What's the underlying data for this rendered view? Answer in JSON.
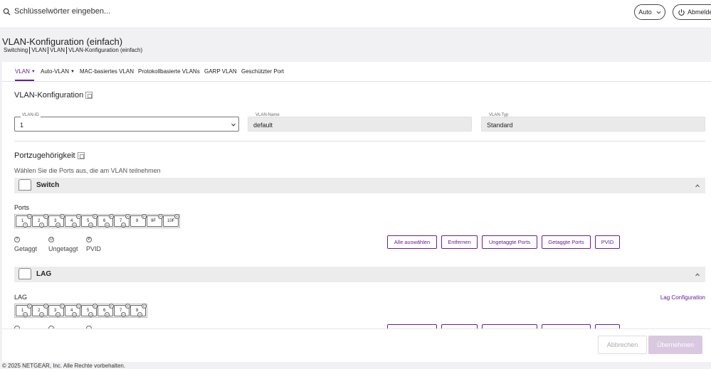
{
  "topbar": {
    "search_placeholder": "Schlüsselwörter eingeben...",
    "auto_label": "Auto",
    "logout_label": "Abmelden"
  },
  "header": {
    "title": "VLAN-Konfiguration (einfach)",
    "breadcrumb": [
      "Switching",
      "VLAN",
      "VLAN",
      "VLAN-Konfiguration (einfach)"
    ]
  },
  "tabs": [
    {
      "label": "VLAN",
      "dropdown": true,
      "active": true
    },
    {
      "label": "Auto-VLAN",
      "dropdown": true,
      "active": false
    },
    {
      "label": "MAC-basiertes VLAN",
      "dropdown": false,
      "active": false
    },
    {
      "label": "Protokollbasierte VLANs",
      "dropdown": false,
      "active": false
    },
    {
      "label": "GARP VLAN",
      "dropdown": false,
      "active": false
    },
    {
      "label": "Geschützter Port",
      "dropdown": false,
      "active": false
    }
  ],
  "vlan_config": {
    "title": "VLAN-Konfiguration",
    "vlan_id_label": "VLAN-ID",
    "vlan_id_value": "1",
    "vlan_name_label": "VLAN-Name",
    "vlan_name_value": "default",
    "vlan_type_label": "VLAN-Typ",
    "vlan_type_value": "Standard"
  },
  "membership": {
    "title": "Portzugehörigkeit",
    "hint": "Wählen Sie die Ports aus, die am VLAN teilnehmen"
  },
  "switch_group": {
    "title": "Switch",
    "ports_label": "Ports",
    "ports": [
      {
        "num": "1",
        "p": "P",
        "s": "T"
      },
      {
        "num": "2",
        "p": "P",
        "s": "T"
      },
      {
        "num": "3",
        "p": "P",
        "s": "U"
      },
      {
        "num": "4",
        "p": "P",
        "s": "U"
      },
      {
        "num": "5",
        "p": "P",
        "s": "U"
      },
      {
        "num": "6",
        "p": "P",
        "s": "U"
      },
      {
        "num": "7",
        "p": "P",
        "s": "U"
      },
      {
        "num": "8",
        "p": "P",
        "s": ""
      },
      {
        "num": "9F",
        "p": "P",
        "s": ""
      },
      {
        "num": "10F",
        "p": "P",
        "s": ""
      }
    ],
    "legend": [
      {
        "symbol": "T",
        "label": "Getaggt"
      },
      {
        "symbol": "U",
        "label": "Ungetaggt"
      },
      {
        "symbol": "P",
        "label": "PVID"
      }
    ],
    "buttons": [
      "Alle auswählen",
      "Entfernen",
      "Ungetaggte Ports",
      "Getaggte Ports",
      "PVID"
    ]
  },
  "lag_group": {
    "title": "LAG",
    "lag_label": "LAG",
    "link_label": "Lag Configuration",
    "ports": [
      {
        "num": "1",
        "p": "P",
        "s": "U"
      },
      {
        "num": "2",
        "p": "P",
        "s": "U"
      },
      {
        "num": "3",
        "p": "P",
        "s": "U"
      },
      {
        "num": "4",
        "p": "P",
        "s": "U"
      },
      {
        "num": "5",
        "p": "P",
        "s": "U"
      },
      {
        "num": "6",
        "p": "P",
        "s": "U"
      },
      {
        "num": "7",
        "p": "P",
        "s": "U"
      },
      {
        "num": "8",
        "p": "P",
        "s": "U"
      }
    ]
  },
  "actions": {
    "cancel_label": "Abbrechen",
    "apply_label": "Übernehmen"
  },
  "footer": {
    "copyright": "© 2025 NETGEAR, Inc. Alle Rechte vorbehalten."
  },
  "colors": {
    "accent": "#6a1b9a",
    "apply_disabled": "#d9c8e0"
  }
}
